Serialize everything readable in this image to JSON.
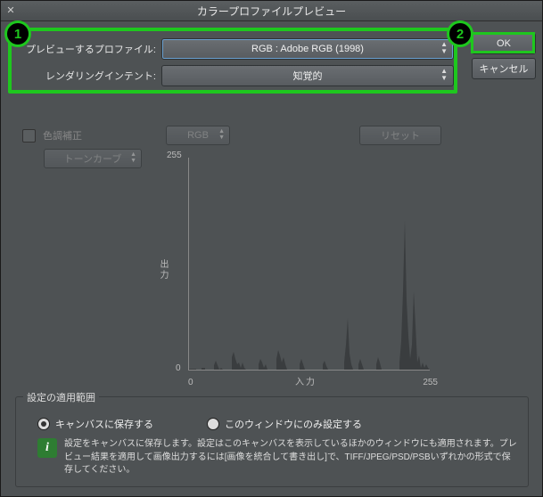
{
  "title": "カラープロファイルプレビュー",
  "callouts": {
    "c1": "1",
    "c2": "2"
  },
  "profile": {
    "label": "プレビューするプロファイル:",
    "value": "RGB : Adobe RGB (1998)"
  },
  "intent": {
    "label": "レンダリングインテント:",
    "value": "知覚的"
  },
  "buttons": {
    "ok": "OK",
    "cancel": "キャンセル",
    "reset": "リセット"
  },
  "tone": {
    "checkbox_label": "色調補正",
    "curve_label": "トーンカーブ",
    "channel": "RGB"
  },
  "histogram": {
    "y_max": "255",
    "y_min": "0",
    "y_label": "出力",
    "x_min": "0",
    "x_max": "255",
    "x_label": "入力"
  },
  "scope": {
    "legend": "設定の適用範囲",
    "opt_canvas": "キャンバスに保存する",
    "opt_window": "このウィンドウにのみ設定する",
    "info": "設定をキャンバスに保存します。設定はこのキャンバスを表示しているほかのウィンドウにも適用されます。プレビュー結果を適用して画像出力するには[画像を統合して書き出し]で、TIFF/JPEG/PSD/PSBいずれかの形式で保存してください。"
  }
}
